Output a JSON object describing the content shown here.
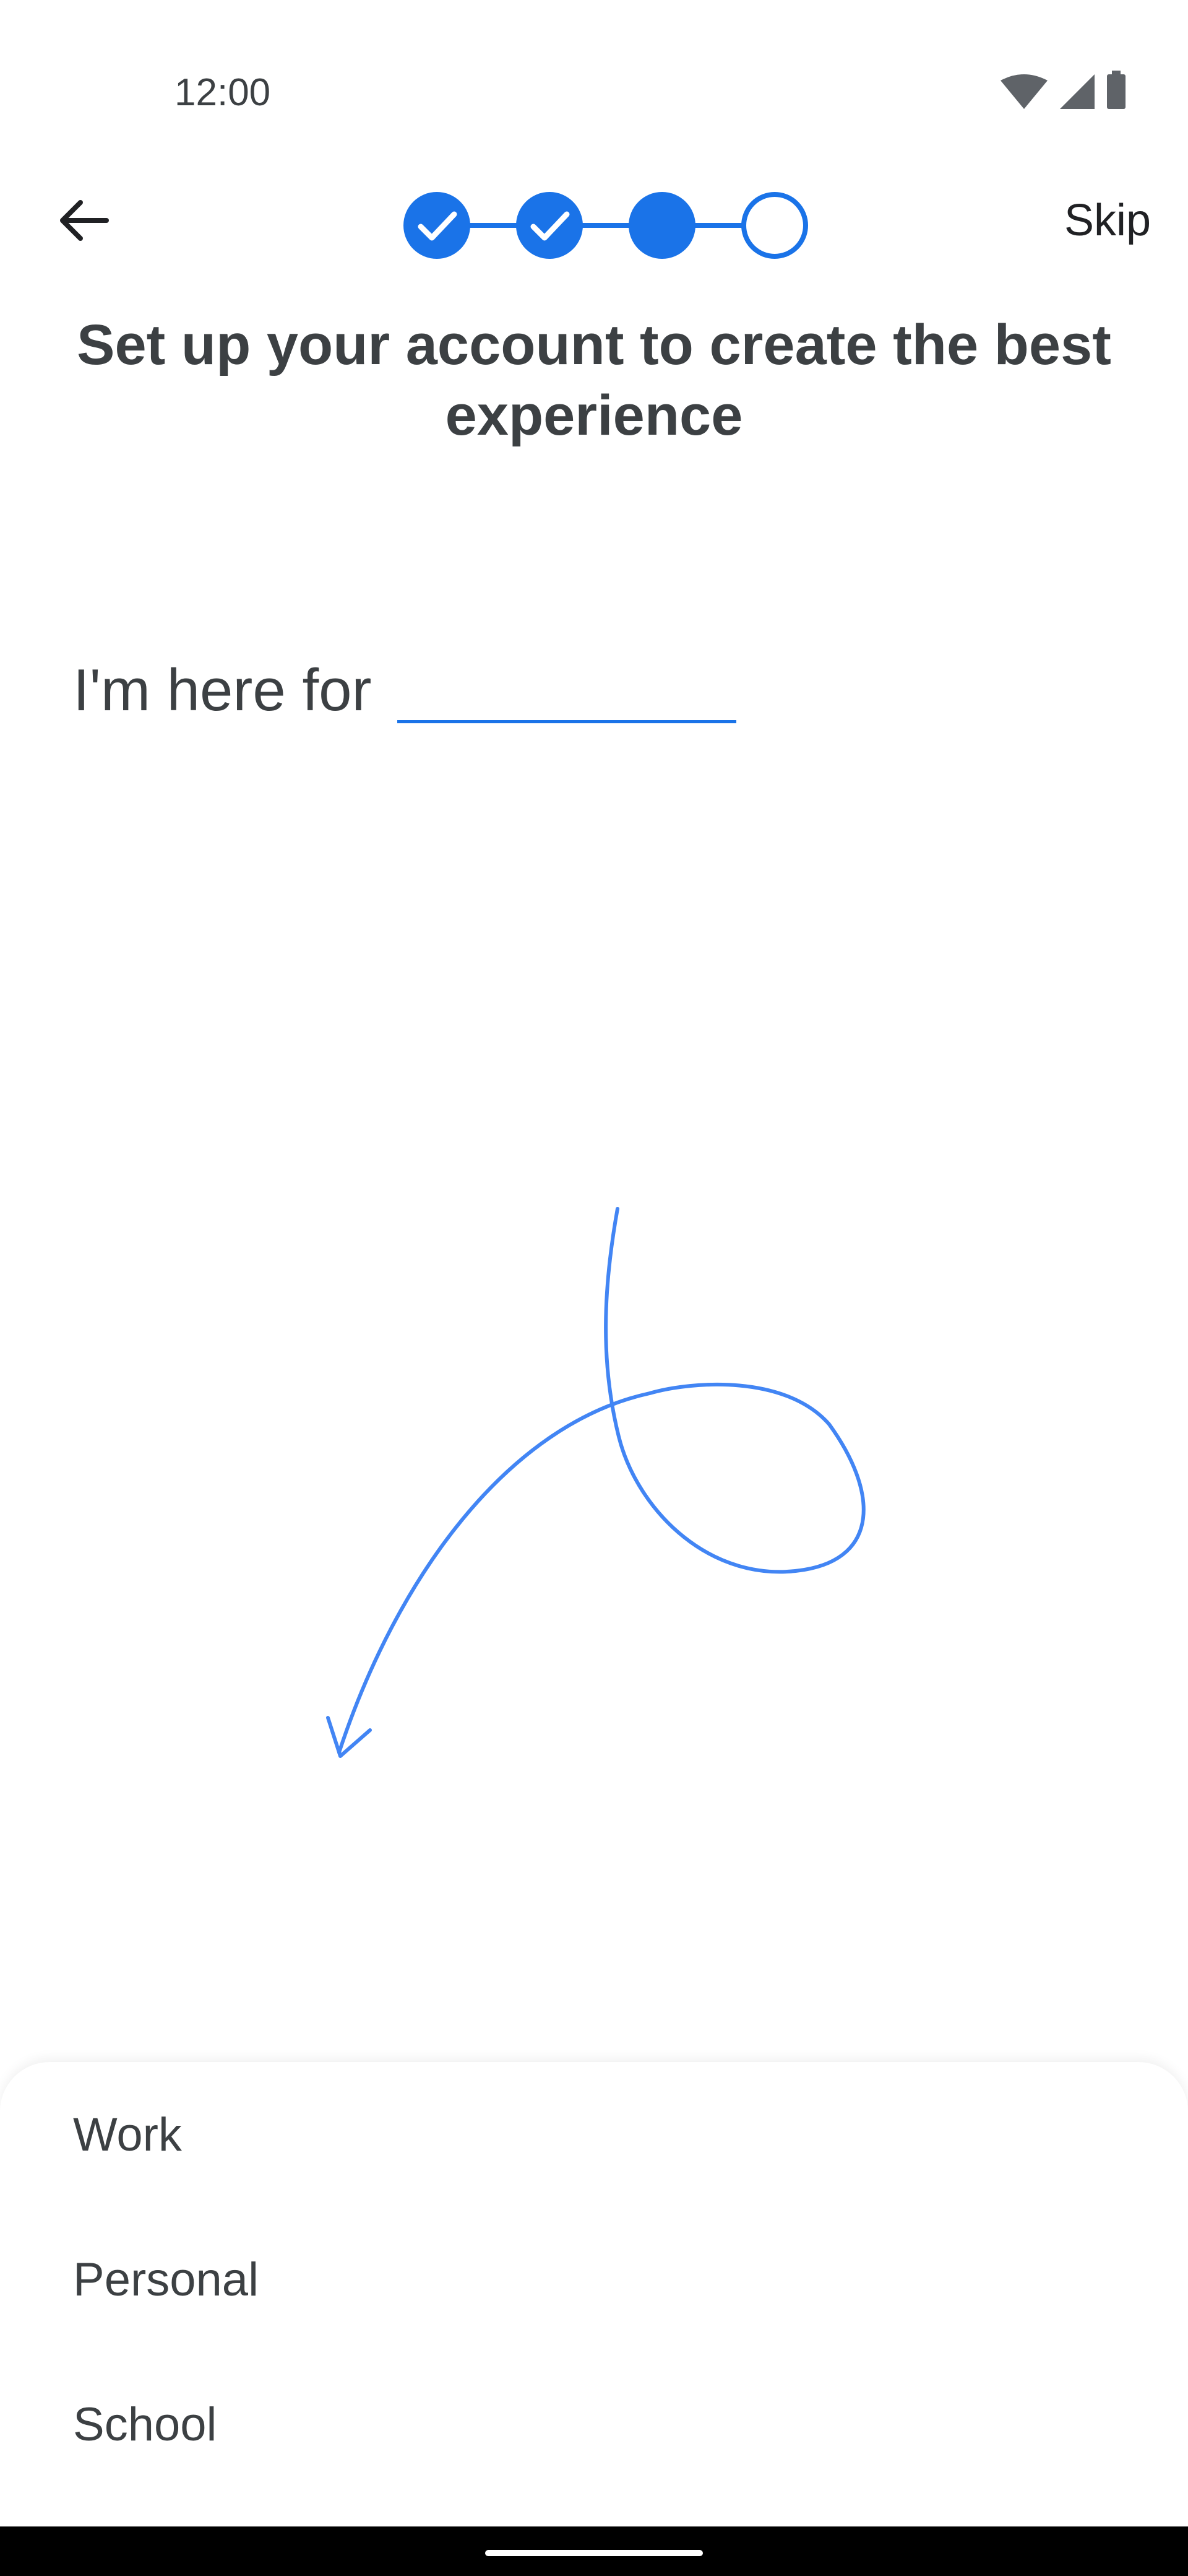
{
  "status_bar": {
    "time": "12:00",
    "icons": [
      "wifi-icon",
      "cell-signal-icon",
      "battery-icon"
    ]
  },
  "top_bar": {
    "back_icon": "arrow-back-icon",
    "skip_label": "Skip"
  },
  "stepper": {
    "steps": [
      {
        "state": "completed",
        "icon": "check-icon"
      },
      {
        "state": "completed",
        "icon": "check-icon"
      },
      {
        "state": "current"
      },
      {
        "state": "upcoming"
      }
    ],
    "accent_color": "#1a73e8"
  },
  "heading": "Set up your account to create the best experience",
  "prompt": {
    "text": "I'm here for",
    "blank_value": ""
  },
  "illustration": {
    "icon": "curly-arrow-icon",
    "color": "#4285f4"
  },
  "options": [
    {
      "label": "Work"
    },
    {
      "label": "Personal"
    },
    {
      "label": "School"
    }
  ]
}
